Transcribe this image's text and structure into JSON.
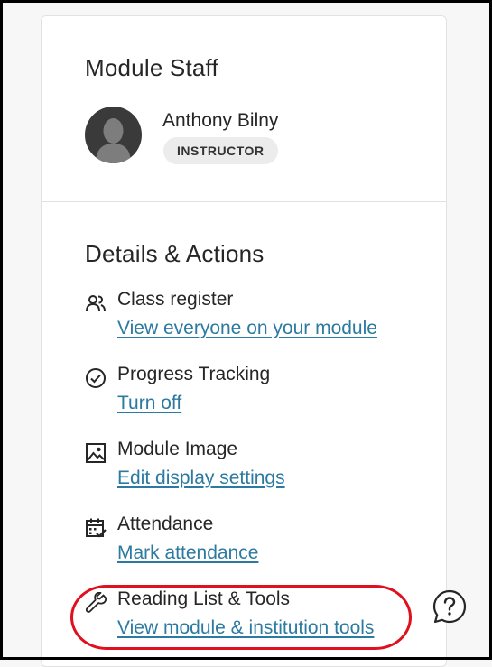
{
  "staff": {
    "title": "Module Staff",
    "name": "Anthony Bilny",
    "role": "INSTRUCTOR"
  },
  "details": {
    "title": "Details & Actions",
    "actions": [
      {
        "label": "Class register",
        "link": "View everyone on your module",
        "icon": "people-icon"
      },
      {
        "label": "Progress Tracking",
        "link": "Turn off",
        "icon": "check-circle-icon"
      },
      {
        "label": "Module Image",
        "link": "Edit display settings",
        "icon": "image-icon"
      },
      {
        "label": "Attendance",
        "link": "Mark attendance",
        "icon": "calendar-check-icon"
      },
      {
        "label": "Reading List & Tools",
        "link": "View module & institution tools",
        "icon": "wrench-icon"
      }
    ]
  },
  "help": {
    "icon": "help-icon"
  },
  "colors": {
    "link": "#2c7aa1",
    "highlight": "#e0101e",
    "text": "#262626"
  }
}
